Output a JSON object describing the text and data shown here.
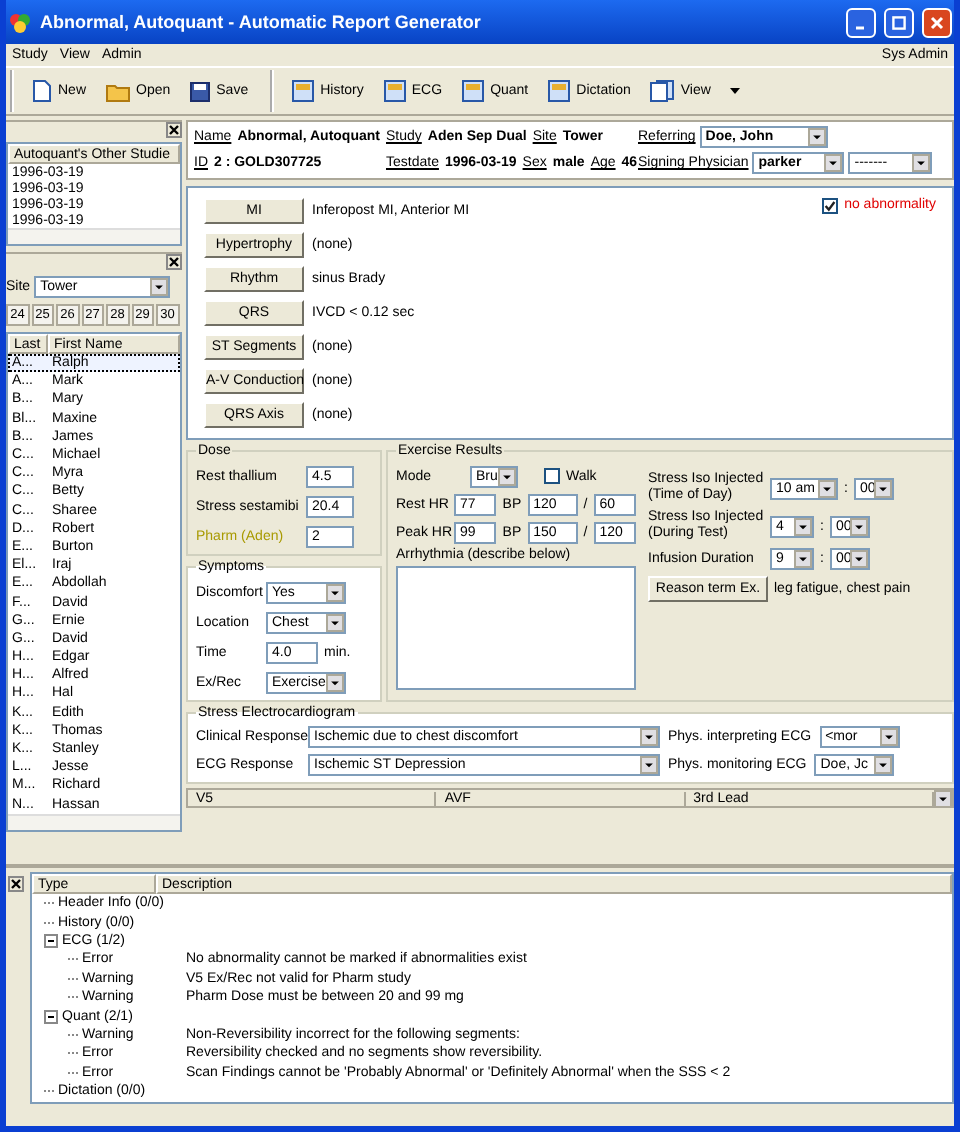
{
  "window": {
    "title": "Abnormal, Autoquant - Automatic Report Generator"
  },
  "menu": [
    {
      "label": "Study"
    },
    {
      "label": "View"
    },
    {
      "label": "Admin"
    }
  ],
  "user": "Sys Admin",
  "toolbars": [
    {
      "buttons": [
        {
          "label": "New",
          "kind": "document",
          "menu": false
        },
        {
          "label": "Open",
          "kind": "folder",
          "menu": false
        },
        {
          "label": "Save",
          "kind": "disk",
          "menu": false
        }
      ]
    },
    {
      "buttons": [
        {
          "label": "History",
          "kind": "window",
          "menu": false
        },
        {
          "label": "ECG",
          "kind": "window",
          "menu": false
        },
        {
          "label": "Quant",
          "kind": "window",
          "menu": false
        },
        {
          "label": "Dictation",
          "kind": "window",
          "menu": false
        },
        {
          "label": "View",
          "kind": "pages",
          "menu": true
        }
      ]
    }
  ],
  "other_studies": {
    "header": "Autoquant's Other Studie",
    "rows": [
      "1996-03-19",
      "1996-03-19",
      "1996-03-19",
      "1996-03-19"
    ]
  },
  "site": {
    "label": "Site",
    "value": "Tower"
  },
  "days": [
    "24",
    "25",
    "26",
    "27",
    "28",
    "29",
    "30"
  ],
  "patients": {
    "columns": [
      "Last",
      "First Name"
    ],
    "rows": [
      {
        "last": "A...",
        "first": "Ralph",
        "selected": true
      },
      {
        "last": "A...",
        "first": "Mark",
        "selected": false
      },
      {
        "last": "B...",
        "first": "Mary",
        "selected": false
      },
      {
        "last": "Bl...",
        "first": "Maxine",
        "selected": false
      },
      {
        "last": "B...",
        "first": "James",
        "selected": false
      },
      {
        "last": "C...",
        "first": "Michael",
        "selected": false
      },
      {
        "last": "C...",
        "first": "Myra",
        "selected": false
      },
      {
        "last": "C...",
        "first": "Betty",
        "selected": false
      },
      {
        "last": "C...",
        "first": "Sharee",
        "selected": false
      },
      {
        "last": "D...",
        "first": "Robert",
        "selected": false
      },
      {
        "last": "E...",
        "first": "Burton",
        "selected": false
      },
      {
        "last": "El...",
        "first": "Iraj",
        "selected": false
      },
      {
        "last": "E...",
        "first": "Abdollah",
        "selected": false
      },
      {
        "last": "F...",
        "first": "David",
        "selected": false
      },
      {
        "last": "G...",
        "first": "Ernie",
        "selected": false
      },
      {
        "last": "G...",
        "first": "David",
        "selected": false
      },
      {
        "last": "H...",
        "first": "Edgar",
        "selected": false
      },
      {
        "last": "H...",
        "first": "Alfred",
        "selected": false
      },
      {
        "last": "H...",
        "first": "Hal",
        "selected": false
      },
      {
        "last": "K...",
        "first": "Edith",
        "selected": false
      },
      {
        "last": "K...",
        "first": "Thomas",
        "selected": false
      },
      {
        "last": "K...",
        "first": "Stanley",
        "selected": false
      },
      {
        "last": "L...",
        "first": "Jesse",
        "selected": false
      },
      {
        "last": "M...",
        "first": "Richard",
        "selected": false
      },
      {
        "last": "N...",
        "first": "Hassan",
        "selected": false
      }
    ]
  },
  "header": {
    "rows": [
      {
        "cells": [
          {
            "fields": [
              {
                "label": "Name",
                "value": "Abnormal, Autoquant"
              }
            ]
          },
          {
            "fields": [
              {
                "label": "Study",
                "value": "Aden Sep Dual"
              },
              {
                "label": "Site",
                "value": "Tower"
              }
            ]
          }
        ],
        "select": {
          "label": "Referring",
          "values": [
            "Doe, John"
          ]
        }
      },
      {
        "cells": [
          {
            "fields": [
              {
                "label": "ID",
                "value": "2 : GOLD307725"
              }
            ]
          },
          {
            "fields": [
              {
                "label": "Testdate",
                "value": "1996-03-19"
              },
              {
                "label": "Sex",
                "value": "male"
              },
              {
                "label": "Age",
                "value": "46"
              }
            ]
          }
        ],
        "select": {
          "label": "Signing Physician",
          "values": [
            "parker",
            "-------"
          ]
        }
      }
    ]
  },
  "ecg": {
    "findings": [
      {
        "label": "MI",
        "value": "Inferopost MI, Anterior MI"
      },
      {
        "label": "Hypertrophy",
        "value": "(none)"
      },
      {
        "label": "Rhythm",
        "value": "sinus Brady"
      },
      {
        "label": "QRS",
        "value": "IVCD < 0.12 sec"
      },
      {
        "label": "ST Segments",
        "value": "(none)"
      },
      {
        "label": "A-V Conduction",
        "value": "(none)"
      },
      {
        "label": "QRS Axis",
        "value": "(none)"
      }
    ],
    "no_abnormality": {
      "label": "no abnormality",
      "checked": true
    }
  },
  "dose": {
    "title": "Dose",
    "fields": [
      {
        "label": "Rest thallium",
        "value": "4.5",
        "warning": false
      },
      {
        "label": "Stress sestamibi",
        "value": "20.4",
        "warning": false
      },
      {
        "label": "Pharm (Aden)",
        "value": "2",
        "warning": true
      }
    ]
  },
  "symptoms": {
    "title": "Symptoms",
    "fields": [
      {
        "label": "Discomfort",
        "kind": "select",
        "value": "Yes"
      },
      {
        "label": "Location",
        "kind": "select",
        "value": "Chest"
      },
      {
        "label": "Time",
        "kind": "input",
        "value": "4.0",
        "unit": "min."
      },
      {
        "label": "Ex/Rec",
        "kind": "select",
        "value": "Exercise"
      }
    ]
  },
  "exercise": {
    "title": "Exercise Results",
    "mode": {
      "label": "Mode",
      "value": "Bru"
    },
    "walk": {
      "label": "Walk",
      "checked": false
    },
    "heart_rates": [
      {
        "label": "Rest HR",
        "hr": "77",
        "bp_label": "BP",
        "systolic": "120",
        "separator": "/",
        "diastolic": "60"
      },
      {
        "label": "Peak HR",
        "hr": "99",
        "bp_label": "BP",
        "systolic": "150",
        "separator": "/",
        "diastolic": "120"
      }
    ],
    "arrhythmia": {
      "label": "Arrhythmia (describe below)"
    },
    "timings": [
      {
        "label": "Stress Iso Injected (Time of Day)",
        "hour": "10 am",
        "separator": ":",
        "minute": "00"
      },
      {
        "label": "Stress Iso Injected (During Test)",
        "hour": "4",
        "separator": ":",
        "minute": "00"
      },
      {
        "label": "Infusion Duration",
        "hour": "9",
        "separator": ":",
        "minute": "00"
      }
    ],
    "reason": {
      "button": "Reason term Ex.",
      "text": "leg fatigue, chest pain"
    }
  },
  "stress_ecg": {
    "title": "Stress Electrocardiogram",
    "rows": [
      {
        "label": "Clinical Response",
        "value": "Ischemic due to chest discomfort",
        "phys_label": "Phys. interpreting ECG",
        "phys_value": "<mor"
      },
      {
        "label": "ECG Response",
        "value": "Ischemic ST Depression",
        "phys_label": "Phys. monitoring ECG",
        "phys_value": "Doe, Jc"
      }
    ]
  },
  "leads": [
    "V5",
    "AVF",
    "3rd Lead"
  ],
  "log": {
    "columns": [
      "Type",
      "Description"
    ],
    "tree": [
      {
        "label": "Header Info (0/0)"
      },
      {
        "label": "History (0/0)"
      },
      {
        "label": "ECG (1/2)",
        "expanded": true,
        "children": [
          {
            "type": "Error",
            "description": "No abnormality cannot be marked if abnormalities exist"
          },
          {
            "type": "Warning",
            "description": "V5 Ex/Rec not valid for Pharm study"
          },
          {
            "type": "Warning",
            "description": "Pharm Dose must be between 20 and 99 mg"
          }
        ]
      },
      {
        "label": "Quant (2/1)",
        "expanded": true,
        "children": [
          {
            "type": "Warning",
            "description": "Non-Reversibility incorrect for the following segments:"
          },
          {
            "type": "Error",
            "description": "Reversibility checked and no segments show reversibility."
          },
          {
            "type": "Error",
            "description": "Scan Findings cannot be 'Probably Abnormal' or 'Definitely Abnormal' when the SSS < 2"
          }
        ]
      },
      {
        "label": "Dictation (0/0)"
      }
    ]
  }
}
